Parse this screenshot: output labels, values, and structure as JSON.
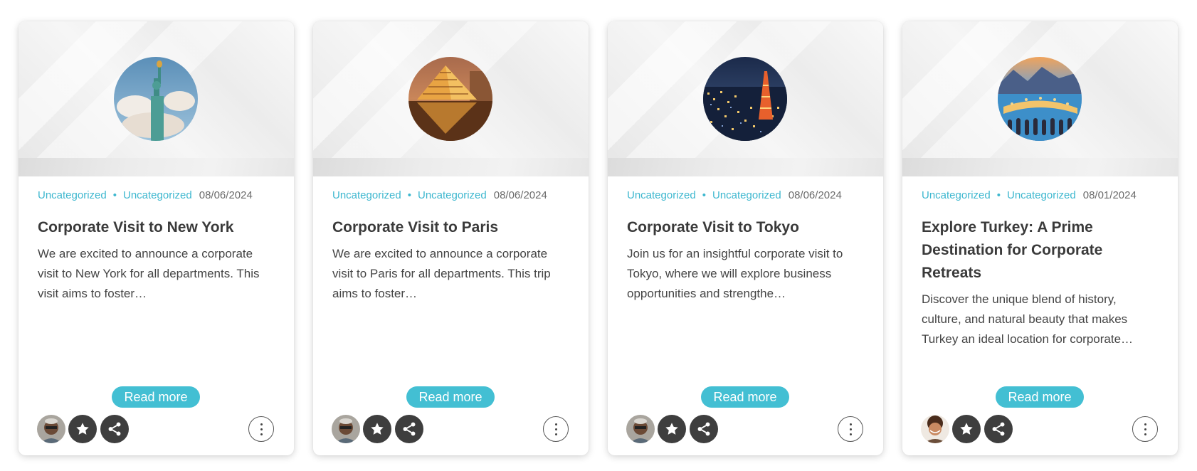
{
  "posts": [
    {
      "category_primary": "Uncategorized",
      "category_secondary": "Uncategorized",
      "date": "08/06/2024",
      "title": "Corporate Visit to New York",
      "excerpt": "We are excited to announce a corporate visit to New York for all departments. This visit aims to foster…",
      "read_more_label": "Read more",
      "thumbnail": "statue-of-liberty-image",
      "author_avatar": "author-avatar-glasses"
    },
    {
      "category_primary": "Uncategorized",
      "category_secondary": "Uncategorized",
      "date": "08/06/2024",
      "title": "Corporate Visit to Paris",
      "excerpt": "We are excited to announce a corporate visit to Paris for all departments. This trip aims to foster…",
      "read_more_label": "Read more",
      "thumbnail": "louvre-pyramid-image",
      "author_avatar": "author-avatar-glasses"
    },
    {
      "category_primary": "Uncategorized",
      "category_secondary": "Uncategorized",
      "date": "08/06/2024",
      "title": "Corporate Visit to Tokyo",
      "excerpt": "Join us for an insightful corporate visit to Tokyo, where we will explore business opportunities and strengthe…",
      "read_more_label": "Read more",
      "thumbnail": "tokyo-night-skyline-image",
      "author_avatar": "author-avatar-glasses"
    },
    {
      "category_primary": "Uncategorized",
      "category_secondary": "Uncategorized",
      "date": "08/01/2024",
      "title": "Explore Turkey: A Prime Destination for Corporate Retreats",
      "excerpt": "Discover the unique blend of history, culture, and natural beauty that makes Turkey an ideal location for corporate…",
      "read_more_label": "Read more",
      "thumbnail": "turkey-coast-image",
      "author_avatar": "author-avatar-curly-hair"
    }
  ],
  "colors": {
    "accent": "#43bfd3",
    "category_text": "#3db7cf",
    "icon_button": "#3e3e3e"
  },
  "icons": [
    "star-icon",
    "share-icon",
    "more-vertical-icon"
  ]
}
